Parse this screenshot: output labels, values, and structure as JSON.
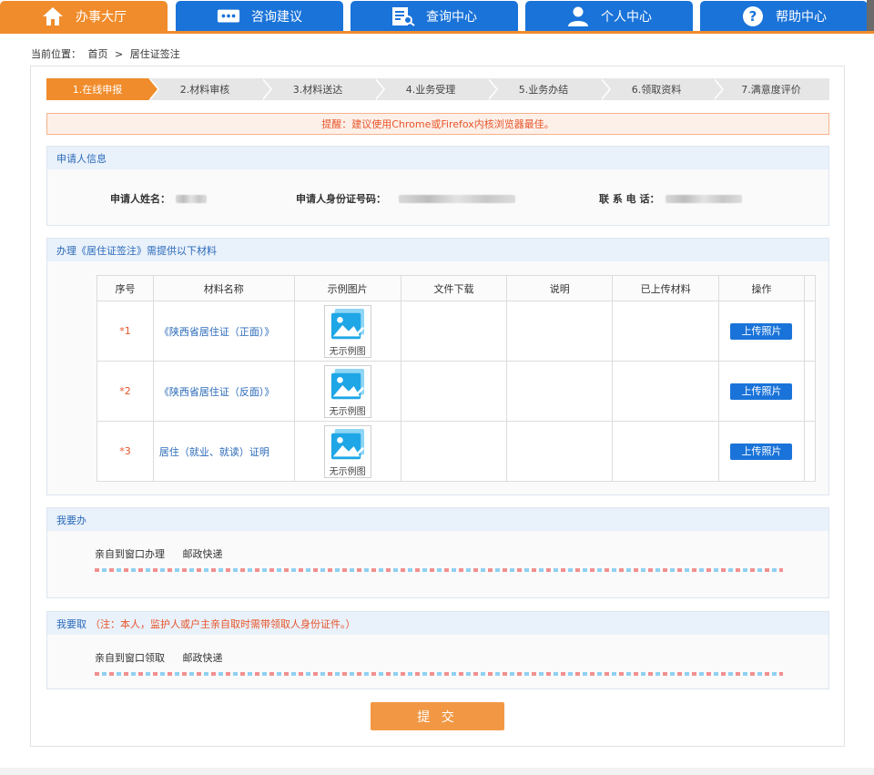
{
  "nav": {
    "tabs": [
      {
        "label": "办事大厅",
        "icon": "home-icon"
      },
      {
        "label": "咨询建议",
        "icon": "chat-icon"
      },
      {
        "label": "查询中心",
        "icon": "search-doc-icon"
      },
      {
        "label": "个人中心",
        "icon": "user-icon"
      },
      {
        "label": "帮助中心",
        "icon": "help-icon"
      }
    ],
    "active_index": 0
  },
  "breadcrumb": {
    "prefix": "当前位置：",
    "home": "首页",
    "sep": ">",
    "current": "居住证签注"
  },
  "steps": [
    "1.在线申报",
    "2.材料审核",
    "3.材料送达",
    "4.业务受理",
    "5.业务办结",
    "6.领取资料",
    "7.满意度评价"
  ],
  "tip": "提醒：建议使用Chrome或Firefox内核浏览器最佳。",
  "applicant": {
    "title": "申请人信息",
    "name_label": "申请人姓名：",
    "id_label": "申请人身份证号码：",
    "phone_label": "联 系 电 话："
  },
  "materials": {
    "title": "办理《居住证签注》需提供以下材料",
    "columns": [
      "序号",
      "材料名称",
      "示例图片",
      "文件下载",
      "说明",
      "已上传材料",
      "操作"
    ],
    "rows": [
      {
        "no": "*1",
        "name": "《陕西省居住证（正面）》",
        "sample": "无示例图",
        "action": "上传照片"
      },
      {
        "no": "*2",
        "name": "《陕西省居住证（反面）》",
        "sample": "无示例图",
        "action": "上传照片"
      },
      {
        "no": "*3",
        "name": "居住（就业、就读）证明",
        "sample": "无示例图",
        "action": "上传照片"
      }
    ]
  },
  "handle": {
    "title": "我要办",
    "options": [
      "亲自到窗口办理",
      "邮政快递"
    ]
  },
  "pickup": {
    "title": "我要取",
    "note": "（注：本人，监护人或户主亲自取时需带领取人身份证件。）",
    "options": [
      "亲自到窗口领取",
      "邮政快递"
    ]
  },
  "submit_label": "提 交",
  "colors": {
    "accent_orange": "#f08c2b",
    "nav_blue": "#1a73d9",
    "link_blue": "#2a6ab8",
    "warn_red": "#e8542a"
  }
}
